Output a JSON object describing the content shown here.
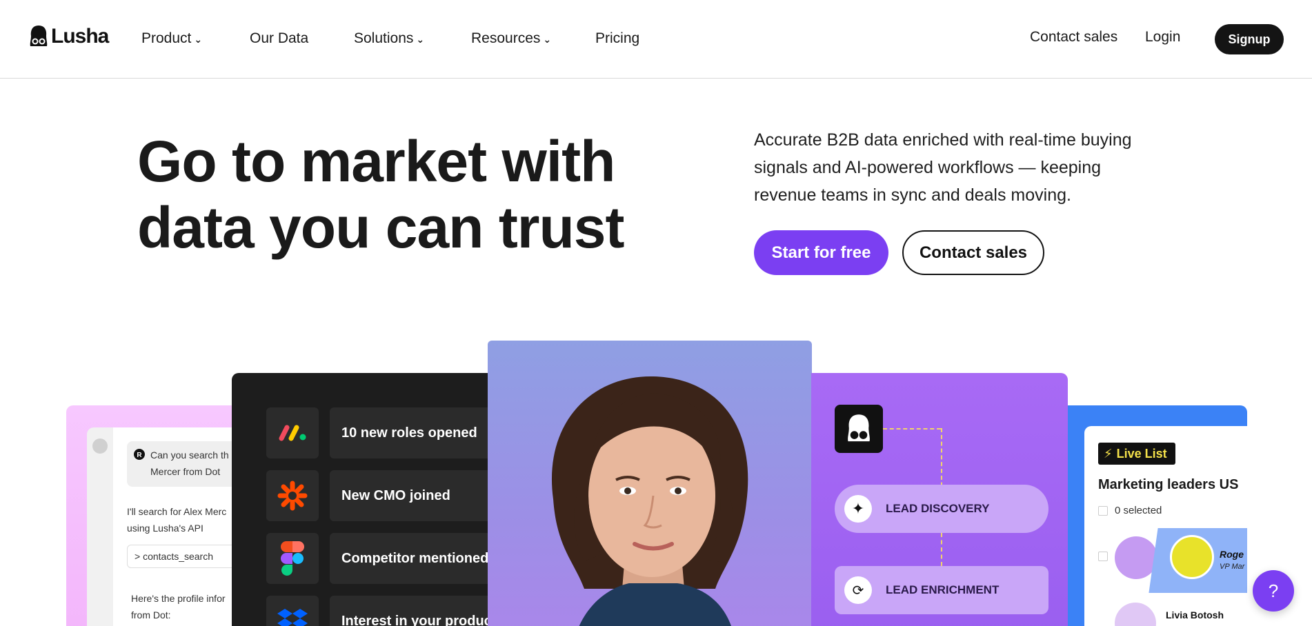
{
  "brand": {
    "name": "Lusha"
  },
  "nav": {
    "items": [
      {
        "label": "Product",
        "has_dropdown": true
      },
      {
        "label": "Our Data",
        "has_dropdown": false
      },
      {
        "label": "Solutions",
        "has_dropdown": true
      },
      {
        "label": "Resources",
        "has_dropdown": true
      },
      {
        "label": "Pricing",
        "has_dropdown": false
      }
    ],
    "contact_sales": "Contact sales",
    "login": "Login",
    "signup": "Signup"
  },
  "hero": {
    "title_line1": "Go to market with",
    "title_line2": "data you can trust",
    "description": "Accurate B2B data enriched with real-time buying signals and AI-powered workflows — keeping revenue teams in sync and deals moving.",
    "primary_cta": "Start for free",
    "secondary_cta": "Contact sales"
  },
  "chat_card": {
    "question": "Can you search th",
    "question_line2": "Mercer from Dot",
    "reply_line1": "I'll search for Alex Merc",
    "reply_line2": "using Lusha's API",
    "command": "> contacts_search",
    "result_line1": "Here's the profile infor",
    "result_line2": "from Dot:"
  },
  "signals_card": {
    "rows": [
      {
        "label": "10 new roles opened",
        "icon": "monday-icon"
      },
      {
        "label": "New CMO joined",
        "icon": "zapier-icon"
      },
      {
        "label": "Competitor mentioned",
        "icon": "figma-icon"
      },
      {
        "label": "Interest in your  product",
        "icon": "dropbox-icon"
      }
    ]
  },
  "workflow_card": {
    "steps": [
      {
        "label": "LEAD DISCOVERY",
        "icon": "sparkle-icon"
      },
      {
        "label": "LEAD ENRICHMENT",
        "icon": "refresh-check-icon"
      }
    ]
  },
  "list_card": {
    "badge": "Live List",
    "title": "Marketing leaders US",
    "selected": "0 selected",
    "person1_name": "Roge",
    "person1_title": "VP Mar",
    "person2_name": "Livia Botosh"
  },
  "help": {
    "label": "?"
  },
  "colors": {
    "accent": "#7b3ff2",
    "dark": "#141414",
    "card_pink": "#f5bffc",
    "card_purple": "#a265f3",
    "card_blue": "#3b82f6"
  }
}
